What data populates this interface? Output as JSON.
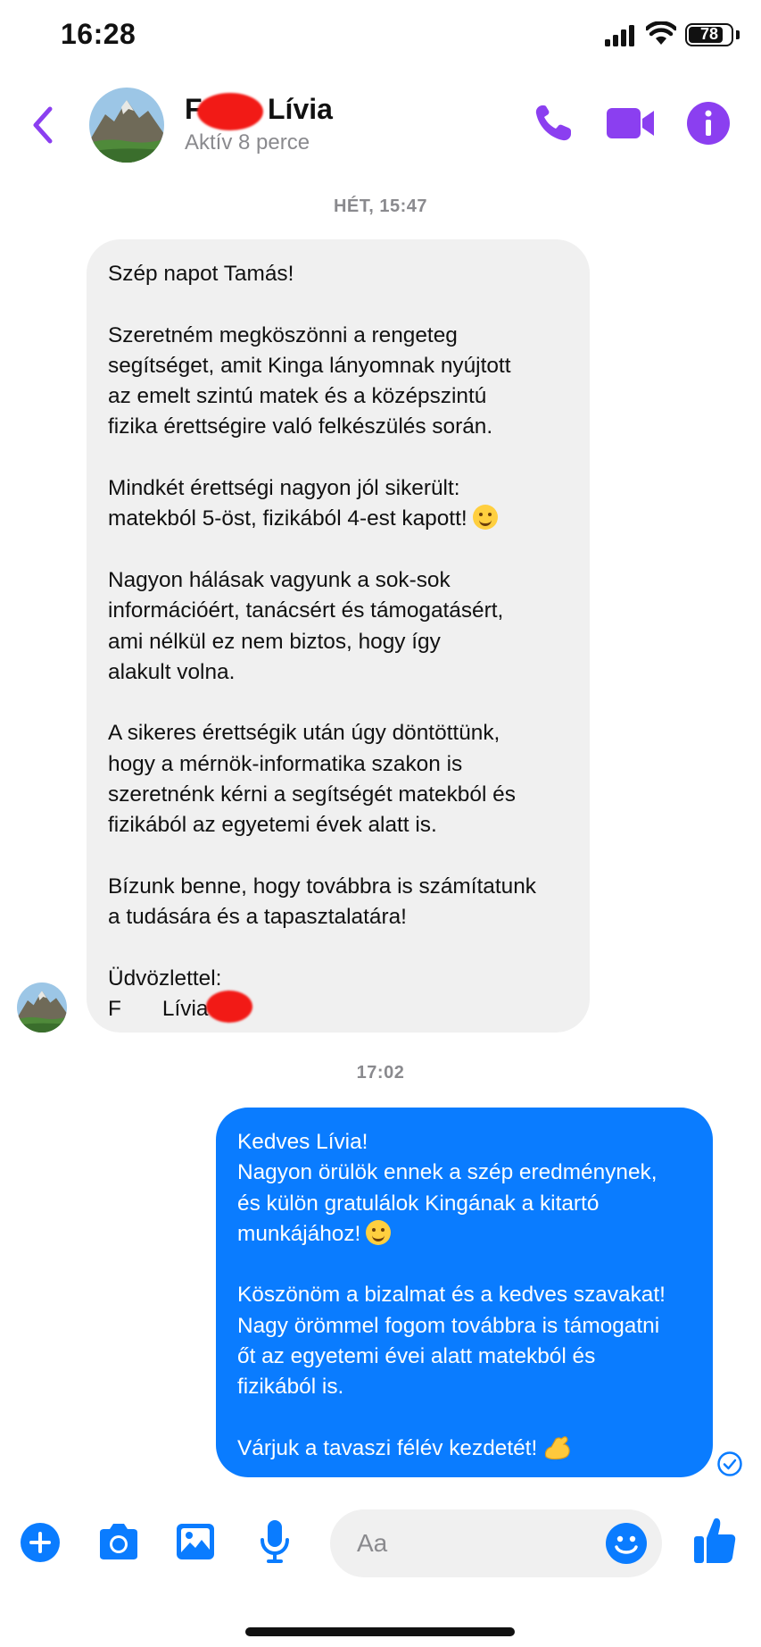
{
  "status_bar": {
    "time": "16:28",
    "battery": "78"
  },
  "header": {
    "name": "Lívia",
    "name_initial": "F",
    "status": "Aktív 8 perce"
  },
  "timestamps": {
    "first": "HÉT, 15:47",
    "second": "17:02"
  },
  "incoming_message": {
    "lines": [
      "Szép napot Tamás!",
      "",
      "Szeretném megköszönni a rengeteg",
      "segítséget, amit Kinga lányomnak nyújtott",
      "az emelt szintú matek és a középszintú",
      "fizika érettségire való felkészülés során.",
      "",
      "Mindkét érettségi nagyon jól sikerült:",
      "matekból 5-öst, fizikából 4-est kapott!",
      "",
      "Nagyon hálásak vagyunk a sok-sok",
      "információért, tanácsért és támogatásért,",
      "ami nélkül ez nem biztos, hogy így",
      "alakult volna.",
      "",
      "A sikeres érettségik után úgy döntöttünk,",
      "hogy a mérnök-informatika szakon is",
      "szeretnénk kérni a segítségét matekból és",
      "fizikából az egyetemi évek alatt is.",
      "",
      "Bízunk benne, hogy továbbra is számítatunk",
      "a tudására és a tapasztalatára!",
      "",
      "Üdvözlettel:",
      "F",
      "Lívia"
    ]
  },
  "outgoing_message": {
    "lines": [
      "Kedves Lívia!",
      "Nagyon örülök ennek a szép eredménynek,",
      "és külön gratulálok Kingának a kitartó",
      "munkájához!",
      "",
      "Köszönöm a bizalmat és a kedves szavakat!",
      "Nagy örömmel fogom továbbra is támogatni",
      "őt az egyetemi évei alatt matekból és",
      "fizikából is.",
      "",
      "Várjuk a tavaszi félév kezdetét!"
    ]
  },
  "composer": {
    "placeholder": "Aa"
  },
  "colors": {
    "accent": "#8b3ff0",
    "messenger_blue": "#0a7cff",
    "bubble_grey": "#f0f0f0"
  },
  "icons": [
    "back-chevron-icon",
    "phone-icon",
    "video-camera-icon",
    "info-icon",
    "plus-icon",
    "camera-icon",
    "image-icon",
    "microphone-icon",
    "emoji-icon",
    "thumbs-up-icon",
    "read-check-icon"
  ]
}
